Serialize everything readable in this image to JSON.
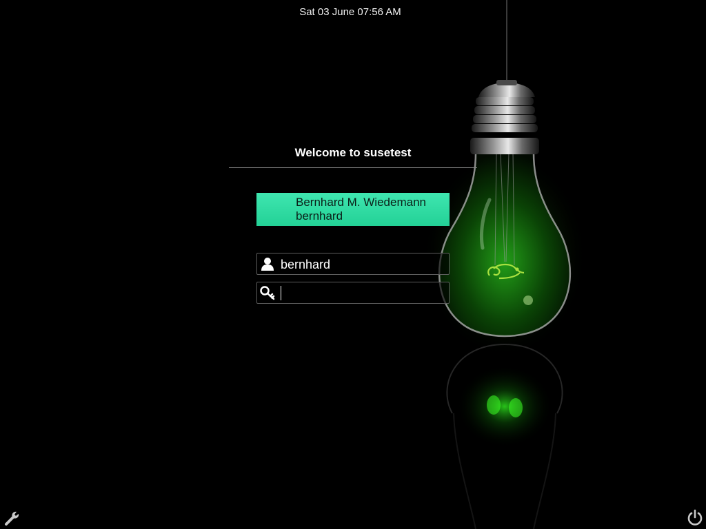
{
  "clock": "Sat 03 June 07:56 AM",
  "greeting": "Welcome to susetest",
  "user_list": [
    {
      "full_name": "Bernhard M. Wiedemann",
      "username": "bernhard"
    }
  ],
  "login": {
    "username_value": "bernhard",
    "password_value": "",
    "username_icon": "user-icon",
    "password_icon": "key-icon"
  },
  "corners": {
    "settings_icon": "wrench-icon",
    "power_icon": "power-icon"
  },
  "colors": {
    "user_highlight": "#2fdca3",
    "bulb_glow": "#22c21e",
    "logo": "#9bd63a"
  }
}
